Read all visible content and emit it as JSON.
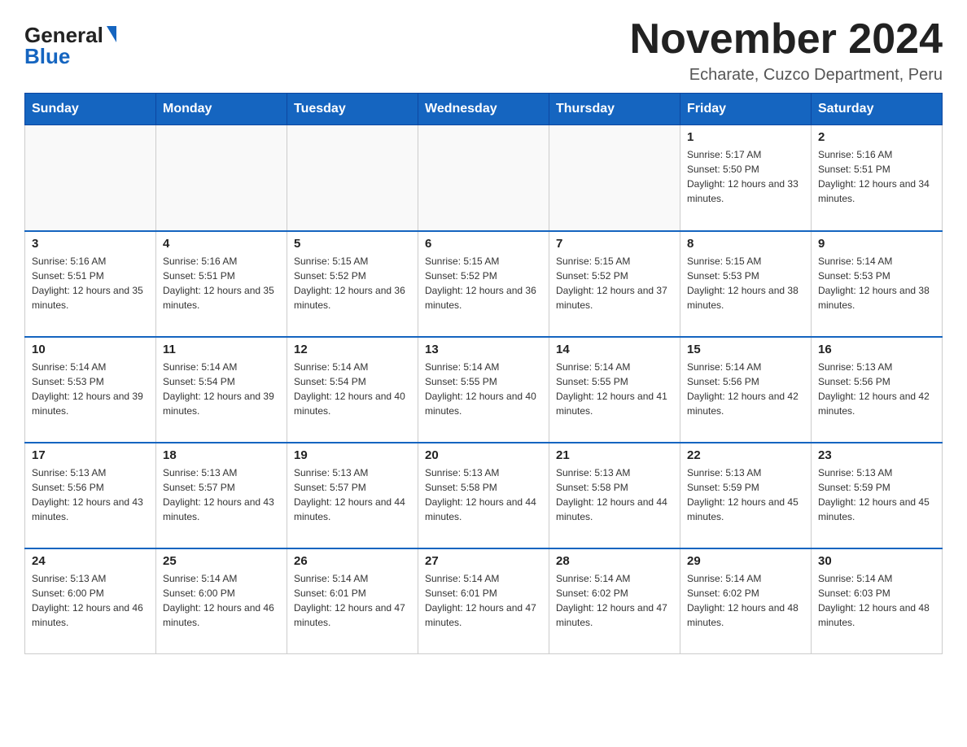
{
  "header": {
    "logo_general": "General",
    "logo_blue": "Blue",
    "month_title": "November 2024",
    "location": "Echarate, Cuzco Department, Peru"
  },
  "days_of_week": [
    "Sunday",
    "Monday",
    "Tuesday",
    "Wednesday",
    "Thursday",
    "Friday",
    "Saturday"
  ],
  "weeks": [
    [
      {
        "day": "",
        "sunrise": "",
        "sunset": "",
        "daylight": ""
      },
      {
        "day": "",
        "sunrise": "",
        "sunset": "",
        "daylight": ""
      },
      {
        "day": "",
        "sunrise": "",
        "sunset": "",
        "daylight": ""
      },
      {
        "day": "",
        "sunrise": "",
        "sunset": "",
        "daylight": ""
      },
      {
        "day": "",
        "sunrise": "",
        "sunset": "",
        "daylight": ""
      },
      {
        "day": "1",
        "sunrise": "Sunrise: 5:17 AM",
        "sunset": "Sunset: 5:50 PM",
        "daylight": "Daylight: 12 hours and 33 minutes."
      },
      {
        "day": "2",
        "sunrise": "Sunrise: 5:16 AM",
        "sunset": "Sunset: 5:51 PM",
        "daylight": "Daylight: 12 hours and 34 minutes."
      }
    ],
    [
      {
        "day": "3",
        "sunrise": "Sunrise: 5:16 AM",
        "sunset": "Sunset: 5:51 PM",
        "daylight": "Daylight: 12 hours and 35 minutes."
      },
      {
        "day": "4",
        "sunrise": "Sunrise: 5:16 AM",
        "sunset": "Sunset: 5:51 PM",
        "daylight": "Daylight: 12 hours and 35 minutes."
      },
      {
        "day": "5",
        "sunrise": "Sunrise: 5:15 AM",
        "sunset": "Sunset: 5:52 PM",
        "daylight": "Daylight: 12 hours and 36 minutes."
      },
      {
        "day": "6",
        "sunrise": "Sunrise: 5:15 AM",
        "sunset": "Sunset: 5:52 PM",
        "daylight": "Daylight: 12 hours and 36 minutes."
      },
      {
        "day": "7",
        "sunrise": "Sunrise: 5:15 AM",
        "sunset": "Sunset: 5:52 PM",
        "daylight": "Daylight: 12 hours and 37 minutes."
      },
      {
        "day": "8",
        "sunrise": "Sunrise: 5:15 AM",
        "sunset": "Sunset: 5:53 PM",
        "daylight": "Daylight: 12 hours and 38 minutes."
      },
      {
        "day": "9",
        "sunrise": "Sunrise: 5:14 AM",
        "sunset": "Sunset: 5:53 PM",
        "daylight": "Daylight: 12 hours and 38 minutes."
      }
    ],
    [
      {
        "day": "10",
        "sunrise": "Sunrise: 5:14 AM",
        "sunset": "Sunset: 5:53 PM",
        "daylight": "Daylight: 12 hours and 39 minutes."
      },
      {
        "day": "11",
        "sunrise": "Sunrise: 5:14 AM",
        "sunset": "Sunset: 5:54 PM",
        "daylight": "Daylight: 12 hours and 39 minutes."
      },
      {
        "day": "12",
        "sunrise": "Sunrise: 5:14 AM",
        "sunset": "Sunset: 5:54 PM",
        "daylight": "Daylight: 12 hours and 40 minutes."
      },
      {
        "day": "13",
        "sunrise": "Sunrise: 5:14 AM",
        "sunset": "Sunset: 5:55 PM",
        "daylight": "Daylight: 12 hours and 40 minutes."
      },
      {
        "day": "14",
        "sunrise": "Sunrise: 5:14 AM",
        "sunset": "Sunset: 5:55 PM",
        "daylight": "Daylight: 12 hours and 41 minutes."
      },
      {
        "day": "15",
        "sunrise": "Sunrise: 5:14 AM",
        "sunset": "Sunset: 5:56 PM",
        "daylight": "Daylight: 12 hours and 42 minutes."
      },
      {
        "day": "16",
        "sunrise": "Sunrise: 5:13 AM",
        "sunset": "Sunset: 5:56 PM",
        "daylight": "Daylight: 12 hours and 42 minutes."
      }
    ],
    [
      {
        "day": "17",
        "sunrise": "Sunrise: 5:13 AM",
        "sunset": "Sunset: 5:56 PM",
        "daylight": "Daylight: 12 hours and 43 minutes."
      },
      {
        "day": "18",
        "sunrise": "Sunrise: 5:13 AM",
        "sunset": "Sunset: 5:57 PM",
        "daylight": "Daylight: 12 hours and 43 minutes."
      },
      {
        "day": "19",
        "sunrise": "Sunrise: 5:13 AM",
        "sunset": "Sunset: 5:57 PM",
        "daylight": "Daylight: 12 hours and 44 minutes."
      },
      {
        "day": "20",
        "sunrise": "Sunrise: 5:13 AM",
        "sunset": "Sunset: 5:58 PM",
        "daylight": "Daylight: 12 hours and 44 minutes."
      },
      {
        "day": "21",
        "sunrise": "Sunrise: 5:13 AM",
        "sunset": "Sunset: 5:58 PM",
        "daylight": "Daylight: 12 hours and 44 minutes."
      },
      {
        "day": "22",
        "sunrise": "Sunrise: 5:13 AM",
        "sunset": "Sunset: 5:59 PM",
        "daylight": "Daylight: 12 hours and 45 minutes."
      },
      {
        "day": "23",
        "sunrise": "Sunrise: 5:13 AM",
        "sunset": "Sunset: 5:59 PM",
        "daylight": "Daylight: 12 hours and 45 minutes."
      }
    ],
    [
      {
        "day": "24",
        "sunrise": "Sunrise: 5:13 AM",
        "sunset": "Sunset: 6:00 PM",
        "daylight": "Daylight: 12 hours and 46 minutes."
      },
      {
        "day": "25",
        "sunrise": "Sunrise: 5:14 AM",
        "sunset": "Sunset: 6:00 PM",
        "daylight": "Daylight: 12 hours and 46 minutes."
      },
      {
        "day": "26",
        "sunrise": "Sunrise: 5:14 AM",
        "sunset": "Sunset: 6:01 PM",
        "daylight": "Daylight: 12 hours and 47 minutes."
      },
      {
        "day": "27",
        "sunrise": "Sunrise: 5:14 AM",
        "sunset": "Sunset: 6:01 PM",
        "daylight": "Daylight: 12 hours and 47 minutes."
      },
      {
        "day": "28",
        "sunrise": "Sunrise: 5:14 AM",
        "sunset": "Sunset: 6:02 PM",
        "daylight": "Daylight: 12 hours and 47 minutes."
      },
      {
        "day": "29",
        "sunrise": "Sunrise: 5:14 AM",
        "sunset": "Sunset: 6:02 PM",
        "daylight": "Daylight: 12 hours and 48 minutes."
      },
      {
        "day": "30",
        "sunrise": "Sunrise: 5:14 AM",
        "sunset": "Sunset: 6:03 PM",
        "daylight": "Daylight: 12 hours and 48 minutes."
      }
    ]
  ]
}
